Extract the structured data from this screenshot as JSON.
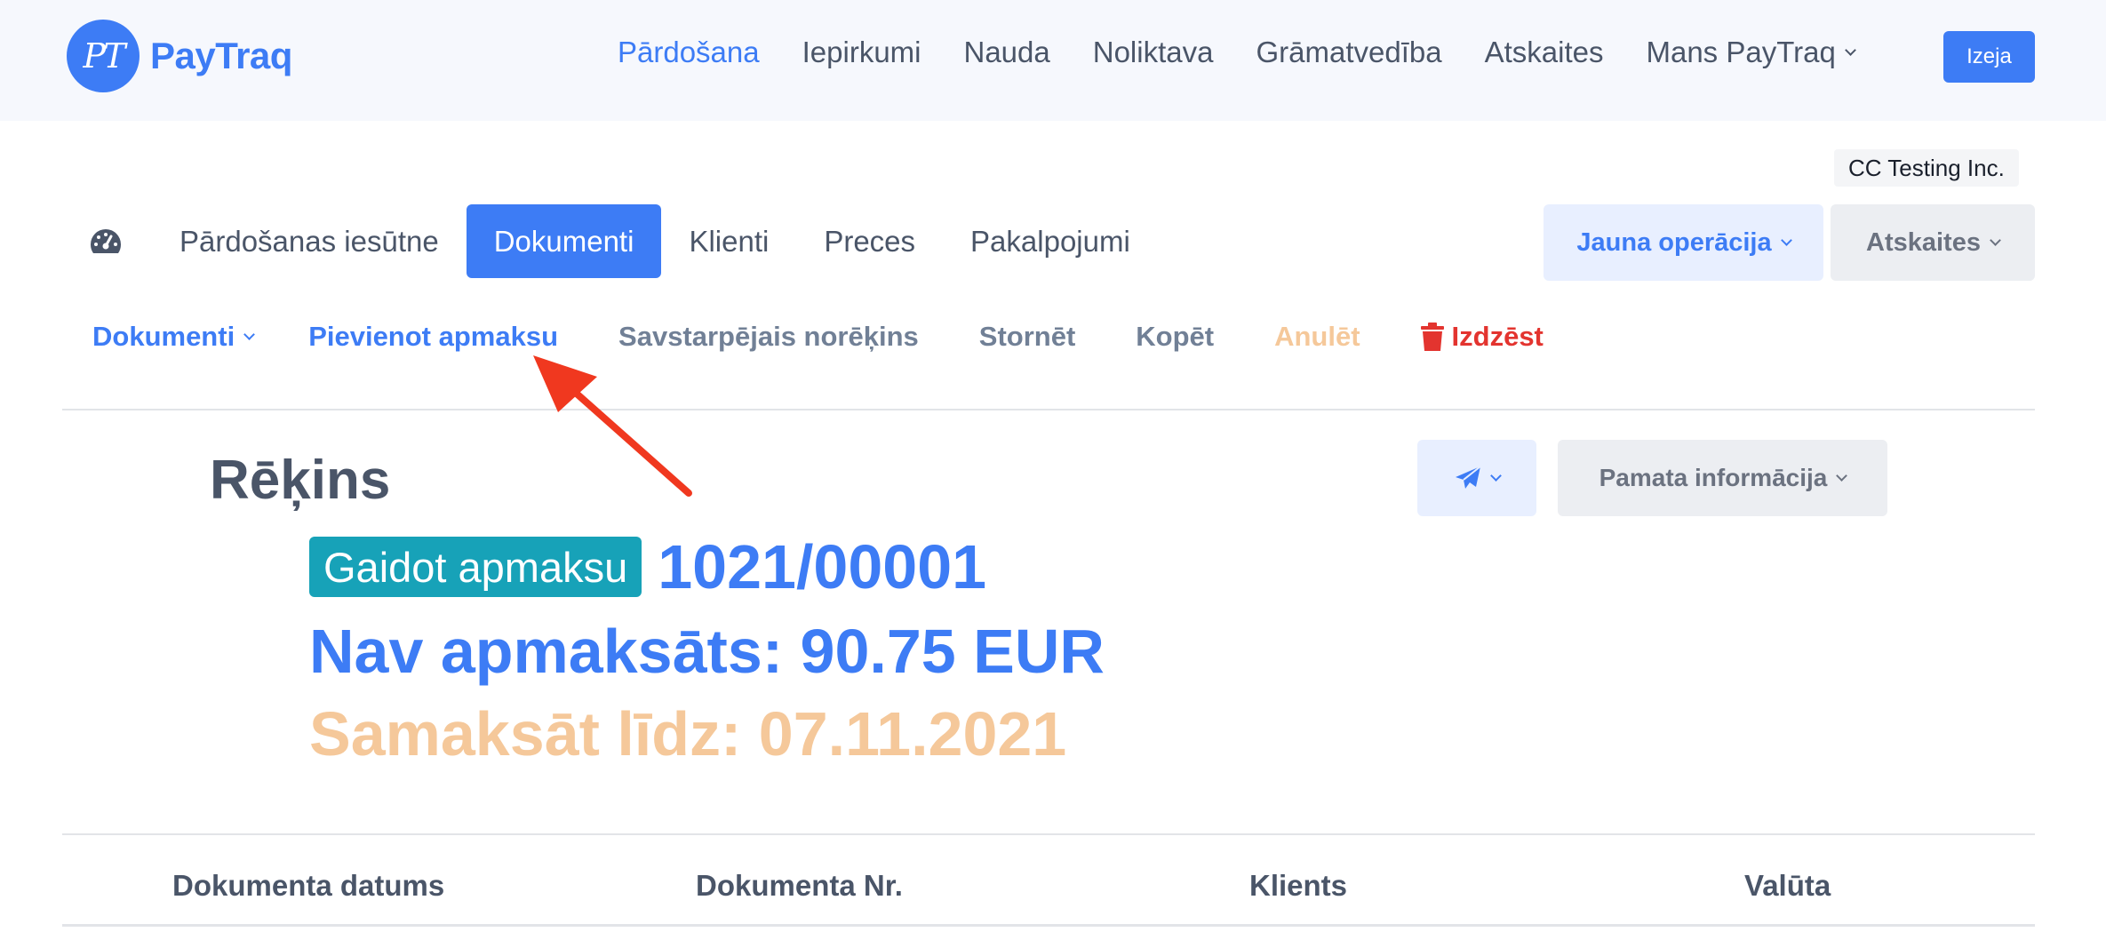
{
  "brand": {
    "logo_initials": "PT",
    "name": "PayTraq"
  },
  "main_nav": [
    {
      "label": "Pārdošana",
      "active": true
    },
    {
      "label": "Iepirkumi"
    },
    {
      "label": "Nauda"
    },
    {
      "label": "Noliktava"
    },
    {
      "label": "Grāmatvedība"
    },
    {
      "label": "Atskaites"
    },
    {
      "label": "Mans PayTraq",
      "dropdown": true
    }
  ],
  "exit_label": "Izeja",
  "company": "CC Testing Inc.",
  "tabs": [
    {
      "label": "Pārdošanas iesūtne"
    },
    {
      "label": "Dokumenti",
      "active": true
    },
    {
      "label": "Klienti"
    },
    {
      "label": "Preces"
    },
    {
      "label": "Pakalpojumi"
    }
  ],
  "new_operation_label": "Jauna operācija",
  "reports_label": "Atskaites",
  "actions": {
    "documents": "Dokumenti",
    "add_payment": "Pievienot apmaksu",
    "offset": "Savstarpējais norēķins",
    "reverse": "Stornēt",
    "copy": "Kopēt",
    "cancel": "Anulēt",
    "delete": "Izdzēst"
  },
  "document": {
    "title": "Rēķins",
    "status": "Gaidot apmaksu",
    "number": "1021/00001",
    "unpaid": "Nav apmaksāts: 90.75 EUR",
    "due": "Samaksāt līdz: 07.11.2021"
  },
  "basic_info_label": "Pamata informācija",
  "table_headers": [
    "Dokumenta datums",
    "Dokumenta Nr.",
    "Klients",
    "Valūta"
  ],
  "icons": {
    "dashboard": "dashboard-gauge-icon",
    "send": "paper-plane-icon",
    "delete": "trash-icon",
    "annotation": "red-arrow-icon"
  },
  "colors": {
    "primary": "#3d7cf5",
    "status_badge": "#17a2b8",
    "warning": "#f5c89a",
    "danger": "#e3342f"
  }
}
